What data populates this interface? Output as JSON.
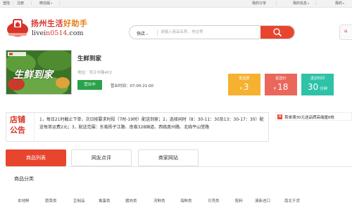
{
  "topbar": {
    "login": "登陆",
    "register": "注册",
    "wechat": "微信版",
    "my_orders": "我的订单",
    "my_messages": "我的信息",
    "user": "我的"
  },
  "brand": {
    "name_a": "扬州生活",
    "name_b": "好助手",
    "url_a": "livei",
    "url_b": "n0514",
    "url_c": ".com"
  },
  "search": {
    "scope": "快店",
    "placeholder": "请输入商品名称、地址等"
  },
  "store": {
    "name": "生鲜到家",
    "address": "地址：邗江中路402",
    "status": "营业中",
    "hours": "营业时间：07:00-21:00",
    "image_caption": "生鲜到家"
  },
  "stats": [
    {
      "label": "配送费",
      "prefix": "¥",
      "value": "3",
      "unit": ""
    },
    {
      "label": "起送价",
      "prefix": "¥",
      "value": "18",
      "unit": ""
    },
    {
      "label": "送达时间",
      "prefix": "",
      "value": "30",
      "unit": "分钟"
    }
  ],
  "notice": {
    "badge_line1": "店铺",
    "badge_line2": "公告",
    "text": "1，每日21时截止下单，次日按要求时段（7时-19时）配送到家；2，选择闲时（8：30-11：30及13：30-17：30）配送每单运费2元；3，配送范围：东临扬子江路、南临328国道、西临真州路、北临平山堂路"
  },
  "promo": {
    "mark": "满",
    "text": "首单满30元送品牌高端厘6枚"
  },
  "tabs": [
    {
      "label": "商品列表"
    },
    {
      "label": "网友点评"
    },
    {
      "label": "商家网站"
    }
  ],
  "categories": {
    "title": "商品分类",
    "items": [
      "本地鲜",
      "蔬菜类",
      "豆制品",
      "禽蛋类",
      "猪肉类",
      "河鲜类",
      "海鲜类",
      "贝壳类",
      "配料",
      "澳新进口",
      "南北干货"
    ]
  },
  "colors": {
    "brand_red": "#e8452e",
    "stat_fee": "#f5b12f",
    "stat_min": "#ea675b",
    "stat_time": "#2ec2a7",
    "status_green": "#2aa24a"
  }
}
